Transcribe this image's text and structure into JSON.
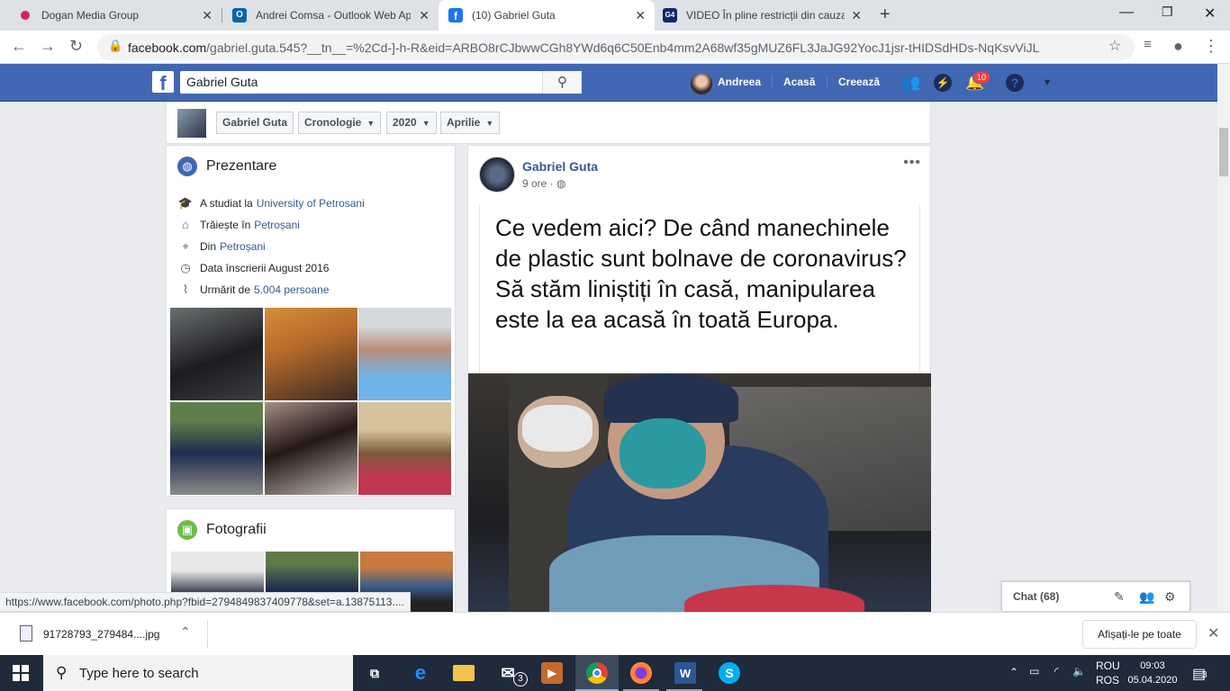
{
  "browser": {
    "tabs": [
      {
        "title": "Dogan Media Group",
        "icon": "dogan-favicon-icon"
      },
      {
        "title": "Andrei Comsa - Outlook Web Ap",
        "icon": "outlook-icon"
      },
      {
        "title": "(10) Gabriel Guta",
        "icon": "facebook-icon"
      },
      {
        "title": "VIDEO În pline restricții din cauza",
        "icon": "g4media-icon"
      }
    ],
    "close_glyph": "✕",
    "new_tab": "+",
    "url_host": "facebook.com",
    "url_rest": "/gabriel.guta.545?__tn__=%2Cd-]-h-R&eid=ARBO8rCJbwwCGh8YWd6q6C50Enb4mm2A68wf35gMUZ6FL3JaJG92YocJ1jsr-tHIDSdHDs-NqKsvViJL"
  },
  "facebook": {
    "search_value": "Gabriel Guta",
    "user_name": "Andreea",
    "nav_home": "Acasă",
    "nav_create": "Creează",
    "notif_count": "10",
    "brand_color": "#4267b2"
  },
  "subnav": {
    "name": "Gabriel Guta",
    "timeline": "Cronologie",
    "year": "2020",
    "month": "Aprilie"
  },
  "intro": {
    "title": "Prezentare",
    "studied_prefix": "A studiat la",
    "studied_link": "University of Petrosani",
    "lives_prefix": "Trăiește în",
    "lives_link": "Petroșani",
    "from_prefix": "Din",
    "from_link": "Petroșani",
    "joined": "Data înscrierii August 2016",
    "followed_prefix": "Urmărit de",
    "followed_link": "5.004 persoane"
  },
  "photos": {
    "title": "Fotografii"
  },
  "post": {
    "author": "Gabriel Guta",
    "time": "9 ore ·",
    "more": "•••",
    "text": "Ce vedem aici? De când manechinele de plastic sunt bolnave de coronavirus? Să stăm liniștiți în casă, manipularea este la ea acasă în toată Europa."
  },
  "chat": {
    "label": "Chat (68)"
  },
  "status_url": "https://www.facebook.com/photo.php?fbid=2794849837409778&set=a.13875113....",
  "download": {
    "filename": "91728793_279484....jpg",
    "show_all": "Afișați-le pe toate"
  },
  "taskbar": {
    "search_placeholder": "Type here to search",
    "mail_badge": "3",
    "lang_top": "ROU",
    "lang_bottom": "ROS",
    "time": "09:03",
    "date": "05.04.2020",
    "notif_count": "3"
  }
}
